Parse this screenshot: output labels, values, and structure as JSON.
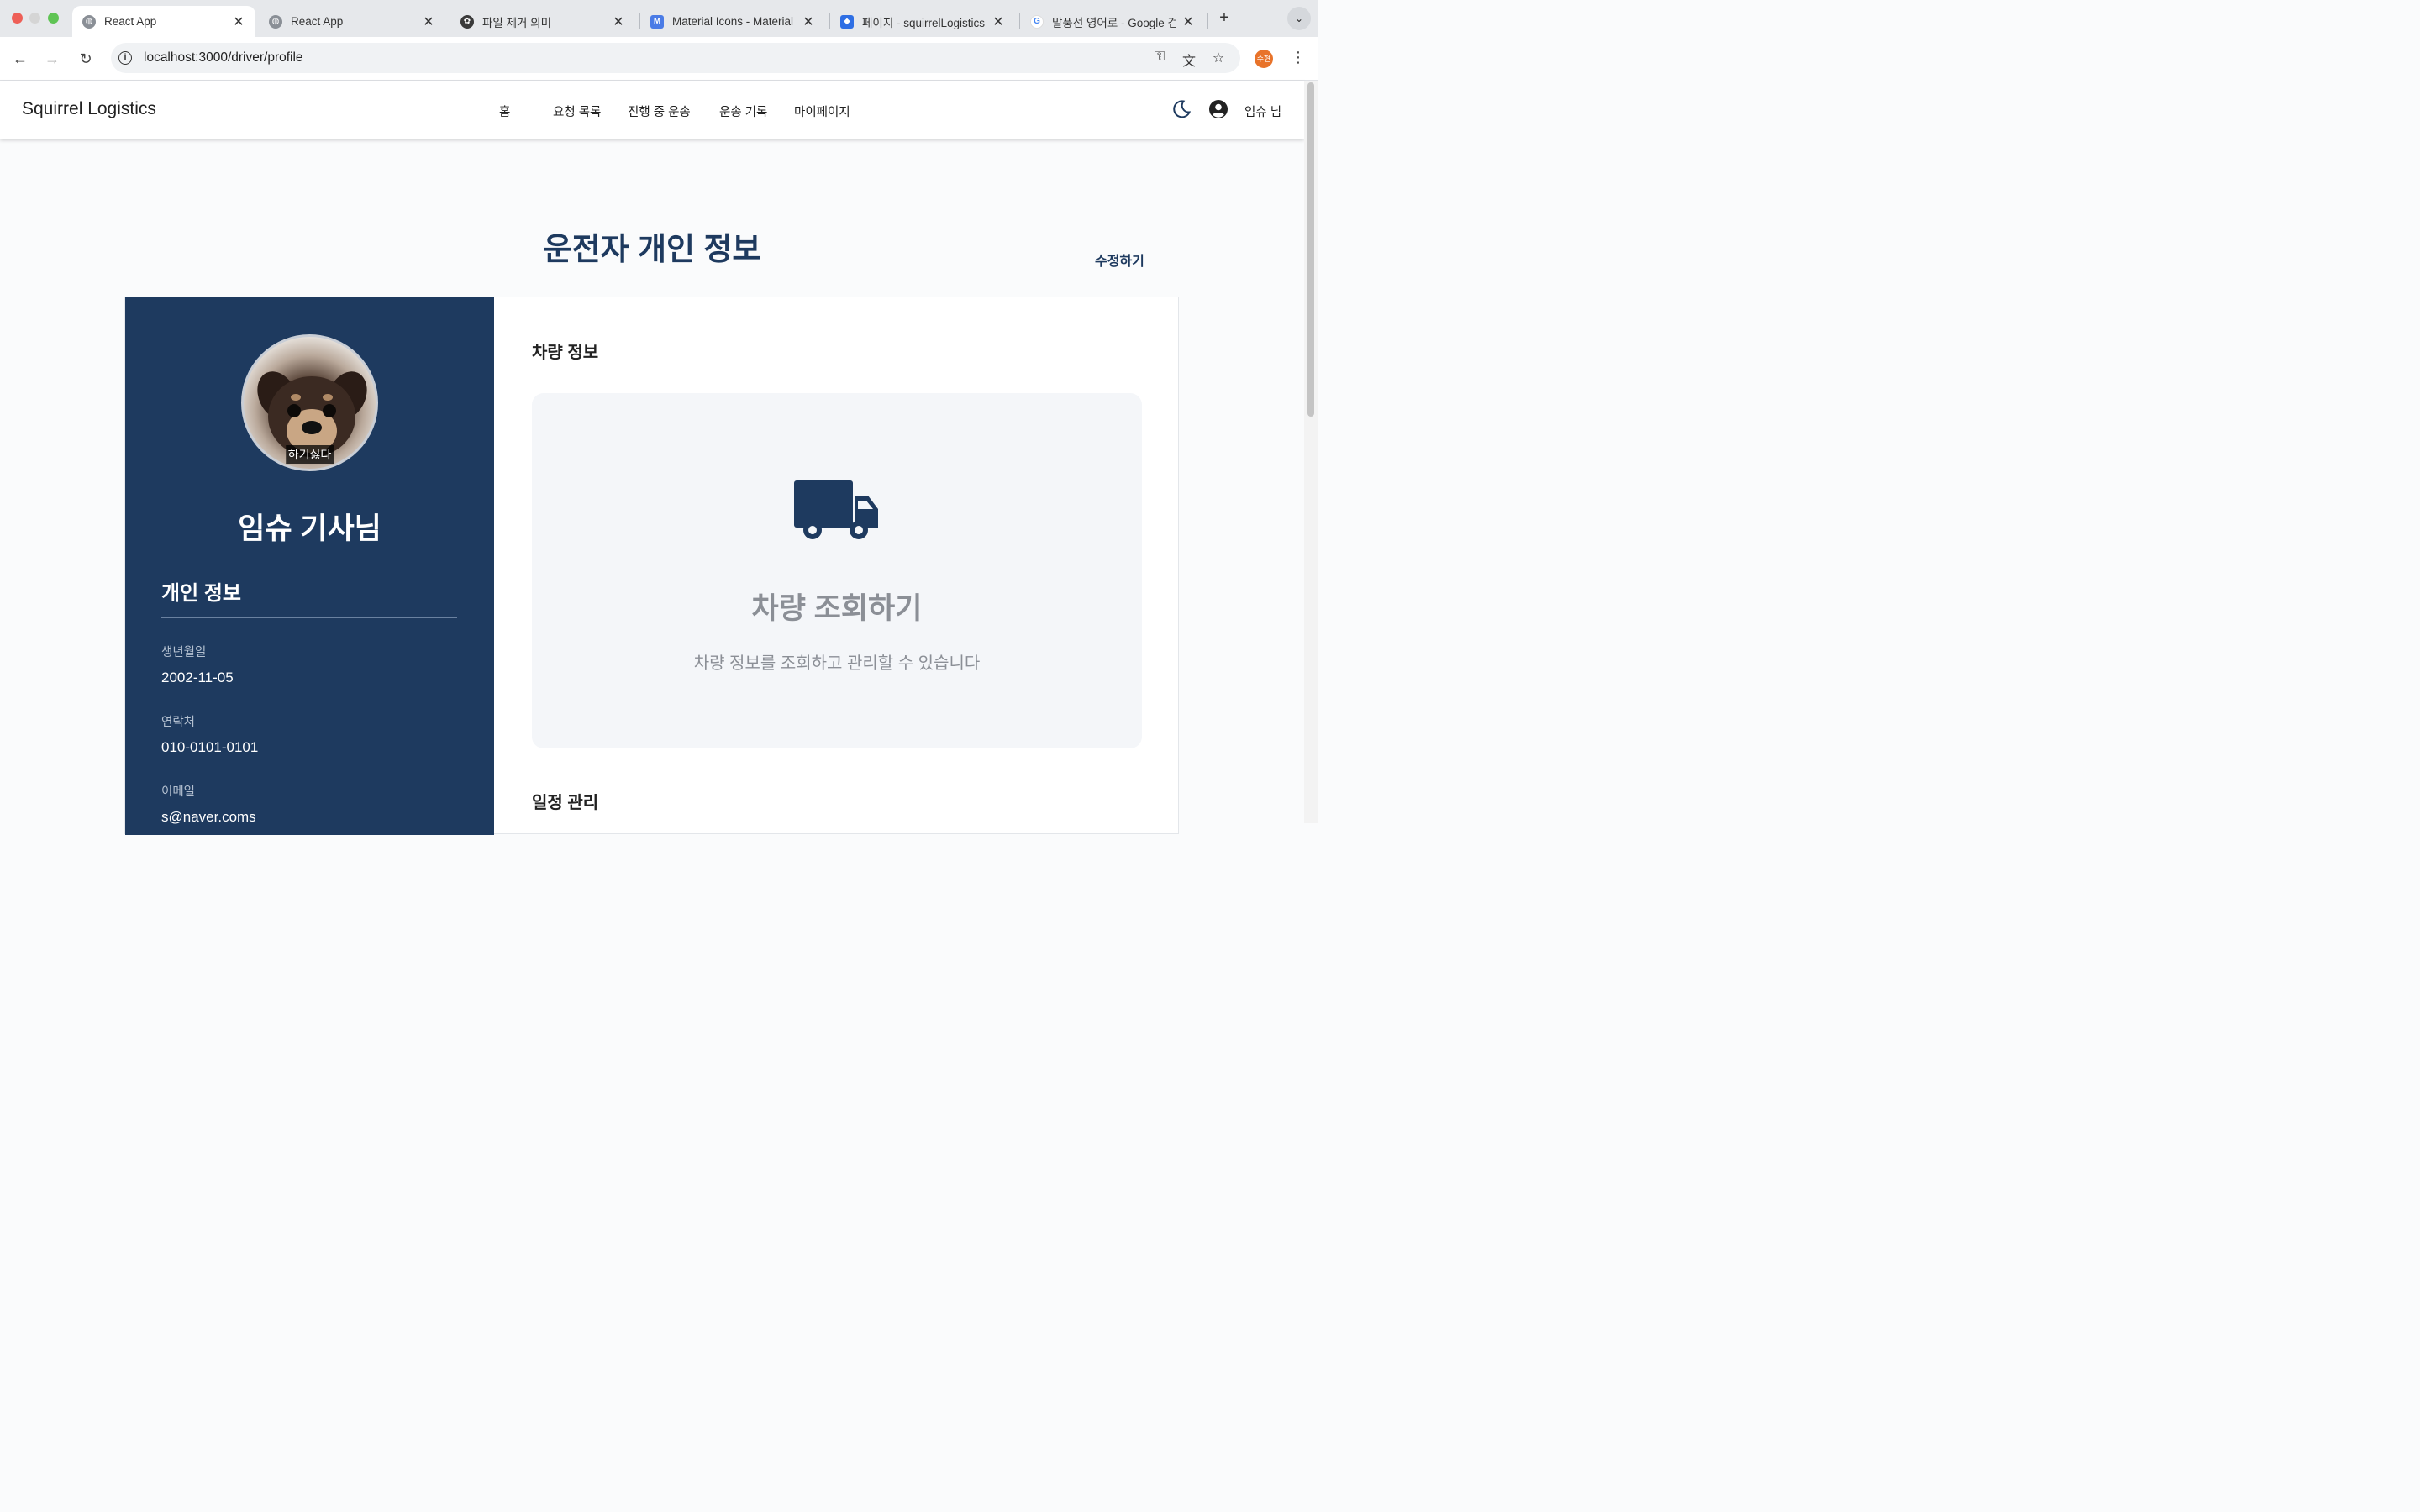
{
  "browser": {
    "tabs": [
      {
        "title": "React App",
        "icon": "globe-icon",
        "active": true
      },
      {
        "title": "React App",
        "icon": "globe-icon",
        "active": false
      },
      {
        "title": "파일 제거 의미",
        "icon": "openai-icon",
        "active": false
      },
      {
        "title": "Material Icons - Material",
        "icon": "material-icon",
        "active": false
      },
      {
        "title": "페이지 - squirrelLogistics",
        "icon": "jira-icon",
        "active": false
      },
      {
        "title": "말풍선 영어로 - Google 검",
        "icon": "google-icon",
        "active": false
      }
    ],
    "close_glyph": "✕",
    "new_tab_glyph": "+",
    "url": "localhost:3000/driver/profile",
    "profile_initials": "수현"
  },
  "header": {
    "brand": "Squirrel Logistics",
    "nav": [
      "홈",
      "요청 목록",
      "진행 중 운송",
      "운송 기록",
      "마이페이지"
    ],
    "user_label": "임슈 님"
  },
  "page": {
    "title": "운전자 개인 정보",
    "edit_label": "수정하기"
  },
  "profile": {
    "avatar_caption": "하기싫다",
    "name": "임슈 기사님",
    "section_title": "개인 정보",
    "fields": [
      {
        "label": "생년월일",
        "value": "2002-11-05"
      },
      {
        "label": "연락처",
        "value": "010-0101-0101"
      },
      {
        "label": "이메일",
        "value": "s@naver.coms"
      }
    ]
  },
  "vehicle": {
    "section_title": "차량 정보",
    "card_title": "차량 조회하기",
    "card_desc": "차량 정보를 조회하고 관리할 수 있습니다"
  },
  "schedule": {
    "section_title": "일정 관리"
  },
  "colors": {
    "primary": "#1e3a5f",
    "muted": "#8b8f96",
    "panel_bg": "#f4f6f9"
  }
}
